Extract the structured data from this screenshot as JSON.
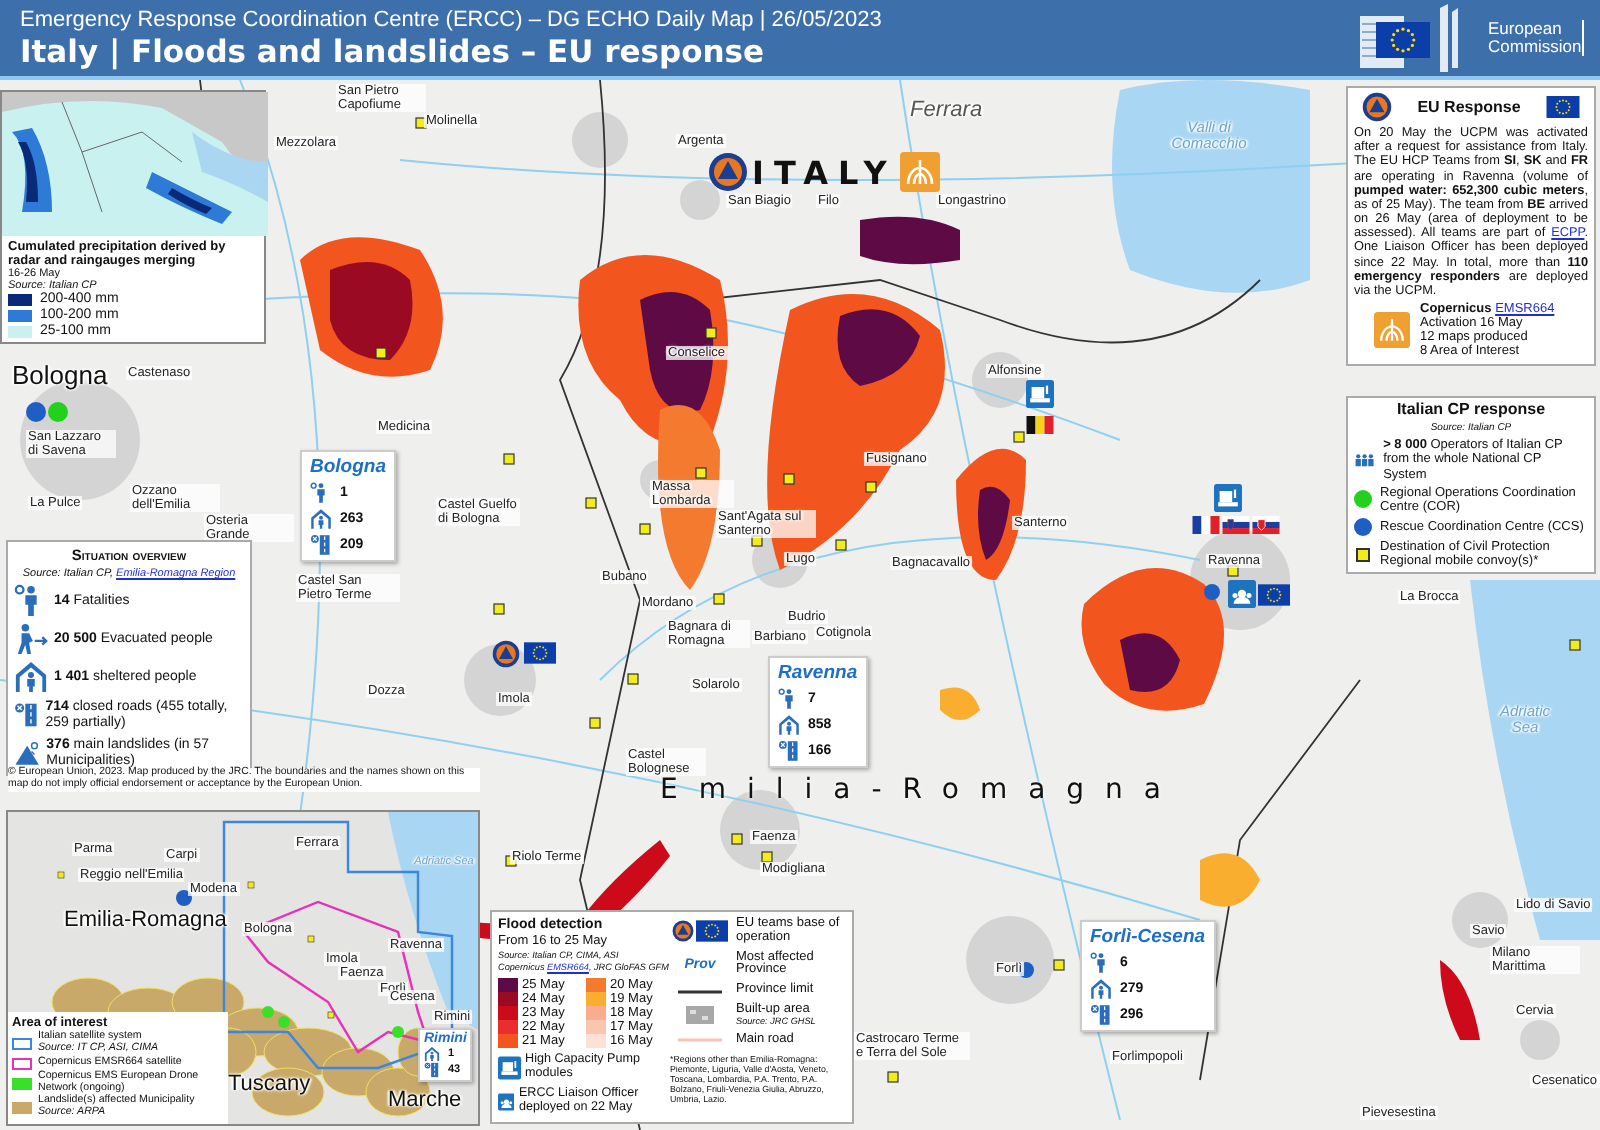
{
  "header": {
    "subtitle": "Emergency Response Coordination Centre (ERCC) – DG ECHO Daily Map | 26/05/2023",
    "title": "Italy | Floods and landslides – EU response",
    "logo_text": "European Commission"
  },
  "country_label": "ITALY",
  "region_label": "Emilia-Romagna",
  "place_labels": [
    {
      "text": "San Pietro Capofiume",
      "kind": "town"
    },
    {
      "text": "Molinella",
      "kind": "town"
    },
    {
      "text": "Mezzolara",
      "kind": "town"
    },
    {
      "text": "Argenta",
      "kind": "town"
    },
    {
      "text": "Ferrara",
      "kind": "province"
    },
    {
      "text": "San Biagio",
      "kind": "town"
    },
    {
      "text": "Filo",
      "kind": "town"
    },
    {
      "text": "Longastrino",
      "kind": "town"
    },
    {
      "text": "Valli di Comacchio",
      "kind": "water"
    },
    {
      "text": "Conselice",
      "kind": "town"
    },
    {
      "text": "Alfonsine",
      "kind": "town"
    },
    {
      "text": "Medicina",
      "kind": "town"
    },
    {
      "text": "Fusignano",
      "kind": "town"
    },
    {
      "text": "Castel Guelfo di Bologna",
      "kind": "town"
    },
    {
      "text": "Massa Lombarda",
      "kind": "town"
    },
    {
      "text": "Sant'Agata sul Santerno",
      "kind": "town"
    },
    {
      "text": "Santerno",
      "kind": "town"
    },
    {
      "text": "Bagnacavallo",
      "kind": "town"
    },
    {
      "text": "Ravenna",
      "kind": "town"
    },
    {
      "text": "Castel San Pietro Terme",
      "kind": "town"
    },
    {
      "text": "Lugo",
      "kind": "town"
    },
    {
      "text": "Bubano",
      "kind": "town"
    },
    {
      "text": "Mordano",
      "kind": "town"
    },
    {
      "text": "Bagnara di Romagna",
      "kind": "town"
    },
    {
      "text": "Budrio",
      "kind": "town"
    },
    {
      "text": "Barbiano",
      "kind": "town"
    },
    {
      "text": "Cotignola",
      "kind": "town"
    },
    {
      "text": "Solarolo",
      "kind": "town"
    },
    {
      "text": "Dozza",
      "kind": "town"
    },
    {
      "text": "Imola",
      "kind": "town"
    },
    {
      "text": "Castel Bolognese",
      "kind": "town"
    },
    {
      "text": "Faenza",
      "kind": "town"
    },
    {
      "text": "Riolo Terme",
      "kind": "town"
    },
    {
      "text": "Modigliana",
      "kind": "town"
    },
    {
      "text": "Forlì",
      "kind": "town"
    },
    {
      "text": "Castrocaro Terme e Terra del Sole",
      "kind": "town"
    },
    {
      "text": "Forlimpopoli",
      "kind": "town"
    },
    {
      "text": "Pievesestina",
      "kind": "town"
    },
    {
      "text": "Bologna",
      "kind": "city"
    },
    {
      "text": "Castenaso",
      "kind": "town"
    },
    {
      "text": "San Lazzaro di Savena",
      "kind": "town"
    },
    {
      "text": "La Pulce",
      "kind": "town"
    },
    {
      "text": "Ozzano dell'Emilia",
      "kind": "town"
    },
    {
      "text": "Osteria Grande",
      "kind": "town"
    },
    {
      "text": "La Brocca",
      "kind": "town"
    },
    {
      "text": "Adriatic Sea",
      "kind": "water"
    },
    {
      "text": "Lido di Savio",
      "kind": "town"
    },
    {
      "text": "Savio",
      "kind": "town"
    },
    {
      "text": "Milano Marittima",
      "kind": "town"
    },
    {
      "text": "Cervia",
      "kind": "town"
    },
    {
      "text": "Cesenatico",
      "kind": "town"
    }
  ],
  "precipitation_inset": {
    "title": "Cumulated precipitation derived by radar and raingauges merging",
    "period": "16-26 May",
    "source": "Source: Italian CP",
    "classes": [
      {
        "label": "200-400 mm",
        "color": "#0a2a78"
      },
      {
        "label": "100-200 mm",
        "color": "#2d7bd6"
      },
      {
        "label": "25-100 mm",
        "color": "#c9f1ef"
      }
    ]
  },
  "situation_overview": {
    "title": "Situation overview",
    "source": "Source: Italian CP, ",
    "source_link": "Emilia-Romagna Region",
    "items": [
      {
        "kind": "fatalities",
        "text": "**14** Fatalities"
      },
      {
        "kind": "evacuated",
        "text": "**20 500** Evacuated people"
      },
      {
        "kind": "sheltered",
        "text": "**1 401** sheltered people"
      },
      {
        "kind": "roads",
        "text": "**714** closed roads (455 totally, 259 partially)"
      },
      {
        "kind": "landslides",
        "text": "**376** main landslides (in 57 Municipalities)"
      }
    ]
  },
  "province_boxes": [
    {
      "name": "Bologna",
      "stats": [
        {
          "kind": "fatalities",
          "value": "1"
        },
        {
          "kind": "sheltered",
          "value": "263"
        },
        {
          "kind": "roads",
          "value": "209"
        }
      ]
    },
    {
      "name": "Ravenna",
      "stats": [
        {
          "kind": "fatalities",
          "value": "7"
        },
        {
          "kind": "sheltered",
          "value": "858"
        },
        {
          "kind": "roads",
          "value": "166"
        }
      ]
    },
    {
      "name": "Forlì-Cesena",
      "stats": [
        {
          "kind": "fatalities",
          "value": "6"
        },
        {
          "kind": "sheltered",
          "value": "279"
        },
        {
          "kind": "roads",
          "value": "296"
        }
      ]
    }
  ],
  "copyright": "© European Union, 2023. Map produced by the JRC. The boundaries and the names shown on this map do not imply official endorsement or acceptance by the European Union.",
  "inset_map": {
    "labels": [
      {
        "text": "Parma",
        "kind": "town"
      },
      {
        "text": "Carpi",
        "kind": "town"
      },
      {
        "text": "Reggio nell'Emilia",
        "kind": "town"
      },
      {
        "text": "Modena",
        "kind": "town"
      },
      {
        "text": "Ferrara",
        "kind": "town"
      },
      {
        "text": "Adriatic Sea",
        "kind": "water"
      },
      {
        "text": "Emilia-Romagna",
        "kind": "region"
      },
      {
        "text": "Bologna",
        "kind": "town"
      },
      {
        "text": "Ravenna",
        "kind": "town"
      },
      {
        "text": "Imola",
        "kind": "town"
      },
      {
        "text": "Faenza",
        "kind": "town"
      },
      {
        "text": "Forlì",
        "kind": "town"
      },
      {
        "text": "Cesena",
        "kind": "town"
      },
      {
        "text": "Rimini",
        "kind": "town"
      },
      {
        "text": "Tuscany",
        "kind": "region"
      },
      {
        "text": "Marche",
        "kind": "region"
      }
    ],
    "province_box": {
      "name": "Rimini",
      "stats": [
        {
          "kind": "sheltered",
          "value": "1"
        },
        {
          "kind": "roads",
          "value": "43"
        }
      ]
    },
    "legend_title": "Area of interest",
    "legend": [
      {
        "kind": "outline",
        "color": "#3a86e0",
        "label": "Italian satellite system",
        "source": "Source: IT CP, ASI, CIMA"
      },
      {
        "kind": "outline",
        "color": "#e830b8",
        "label": "Copernicus EMSR664 satellite"
      },
      {
        "kind": "fill",
        "color": "#39e02a",
        "label": "Copernicus EMS European Drone Network (ongoing)"
      },
      {
        "kind": "fill",
        "color": "#c8a96a",
        "label": "Landslide(s) affected Municipality",
        "source": "Source: ARPA"
      }
    ]
  },
  "flood_legend": {
    "title": "Flood detection",
    "period": "From 16 to 25 May",
    "source": "Source: Italian CP, CIMA, ASI",
    "source_2": "Copernicus ",
    "source_2_link": "EMSR664",
    "source_2_rest": ", JRC GloFAS GFM",
    "dates": [
      {
        "label": "25 May",
        "color": "#5e0b45"
      },
      {
        "label": "24 May",
        "color": "#9a0a22"
      },
      {
        "label": "23 May",
        "color": "#cc0a1a"
      },
      {
        "label": "22 May",
        "color": "#ea2e2e"
      },
      {
        "label": "21 May",
        "color": "#f2561e"
      },
      {
        "label": "20 May",
        "color": "#f47a30"
      },
      {
        "label": "19 May",
        "color": "#f9ae30"
      },
      {
        "label": "18 May",
        "color": "#f8ae8e"
      },
      {
        "label": "17 May",
        "color": "#fbc6b0"
      },
      {
        "label": "16 May",
        "color": "#fde0d6"
      }
    ],
    "symbols": [
      {
        "kind": "base",
        "label": "EU teams base of operation"
      },
      {
        "kind": "province",
        "mark": "Prov",
        "label": "Most affected Province"
      },
      {
        "kind": "limit",
        "label": "Province limit"
      },
      {
        "kind": "builtup",
        "label": "Built-up area",
        "source": "Source: JRC GHSL"
      },
      {
        "kind": "road",
        "label": "Main road"
      }
    ],
    "modules": [
      {
        "kind": "pump",
        "label": "High Capacity Pump modules"
      },
      {
        "kind": "liaison",
        "label": "ERCC Liaison Officer deployed on 22 May"
      }
    ],
    "footnote": "*Regions other than Emilia-Romagna: Piemonte, Liguria, Valle d'Aosta, Veneto, Toscana, Lombardia, P.A. Trento, P.A. Bolzano, Friuli-Venezia Giulia, Abruzzo, Umbria, Lazio."
  },
  "eu_response": {
    "title": "EU Response",
    "text_before": "On 20 May the UCPM was activated after a request for assistance from Italy. The EU HCP Teams from **SI**, **SK** and **FR** are operating in Ravenna (volume of **pumped water: 652,300 cubic meters**, as of 25 May). The team from **BE** arrived on 26 May (area of deployment to be assessed). All teams are part of ",
    "link": "ECPP",
    "text_after": ". One Liaison Officer has been deployed since 22 May. In total, more than **110 emergency responders** are deployed via the UCPM.",
    "copernicus": {
      "name": "Copernicus ",
      "link": "EMSR664",
      "lines": [
        "Activation 16 May",
        "12 maps produced",
        "8 Area of Interest"
      ]
    }
  },
  "italian_cp_response": {
    "title": "Italian CP response",
    "source": "Source: Italian CP",
    "operators": "**> 8 000** Operators of Italian CP from the whole National CP System",
    "legend": [
      {
        "kind": "dot",
        "color": "#22d11e",
        "label": "Regional Operations Coordination Centre (COR)"
      },
      {
        "kind": "dot",
        "color": "#1f5fc4",
        "label": "Rescue Coordination Centre (CCS)"
      },
      {
        "kind": "square",
        "color": "#f2ec1a",
        "label": "Destination of Civil Protection Regional mobile convoy(s)*"
      }
    ]
  }
}
